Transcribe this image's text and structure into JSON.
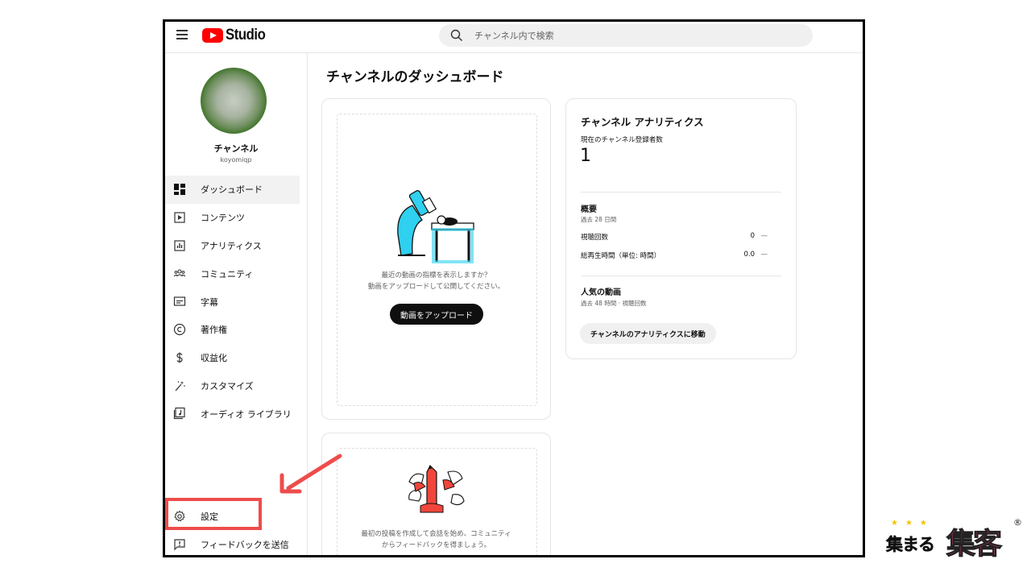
{
  "topbar": {
    "logo_text": "Studio",
    "search_placeholder": "チャンネル内で検索"
  },
  "channel": {
    "name": "チャンネル",
    "handle": "koyomiqp"
  },
  "sidebar": {
    "items": [
      {
        "label": "ダッシュボード",
        "icon": "dashboard-icon",
        "active": true
      },
      {
        "label": "コンテンツ",
        "icon": "content-icon"
      },
      {
        "label": "アナリティクス",
        "icon": "analytics-icon"
      },
      {
        "label": "コミュニティ",
        "icon": "community-icon"
      },
      {
        "label": "字幕",
        "icon": "subtitles-icon"
      },
      {
        "label": "著作権",
        "icon": "copyright-icon"
      },
      {
        "label": "収益化",
        "icon": "dollar-icon"
      },
      {
        "label": "カスタマイズ",
        "icon": "magic-wand-icon"
      },
      {
        "label": "オーディオ ライブラリ",
        "icon": "audio-library-icon"
      }
    ],
    "bottom_items": [
      {
        "label": "設定",
        "icon": "gear-icon"
      },
      {
        "label": "フィードバックを送信",
        "icon": "feedback-icon"
      }
    ]
  },
  "main": {
    "title": "チャンネルのダッシュボード",
    "upload_card": {
      "line1": "最近の動画の指標を表示しますか？",
      "line2": "動画をアップロードして公開してください。",
      "button": "動画をアップロード"
    },
    "community_card": {
      "line1": "最初の投稿を作成して会話を始め、コミュニティ",
      "line2": "からフィードバックを得ましょう。"
    },
    "analytics": {
      "title": "チャンネル アナリティクス",
      "subscribers_label": "現在のチャンネル登録者数",
      "subscribers_value": "1",
      "summary_heading": "概要",
      "summary_period": "過去 28 日間",
      "rows": [
        {
          "label": "視聴回数",
          "value": "0",
          "delta": "—"
        },
        {
          "label": "総再生時間（単位: 時間）",
          "value": "0.0",
          "delta": "—"
        }
      ],
      "popular_heading": "人気の動画",
      "popular_period": "過去 48 時間 · 視聴回数",
      "button": "チャンネルのアナリティクスに移動"
    }
  },
  "watermark": {
    "stars": "★★★",
    "small_text": "集まる",
    "big_text": "集客",
    "reg": "®"
  },
  "colors": {
    "brand_red": "#ff0000",
    "highlight": "#ee4c4c",
    "illustration_cyan": "#2fd0f0",
    "illustration_red": "#f0463c",
    "watermark_pink": "#ff3d8f"
  }
}
